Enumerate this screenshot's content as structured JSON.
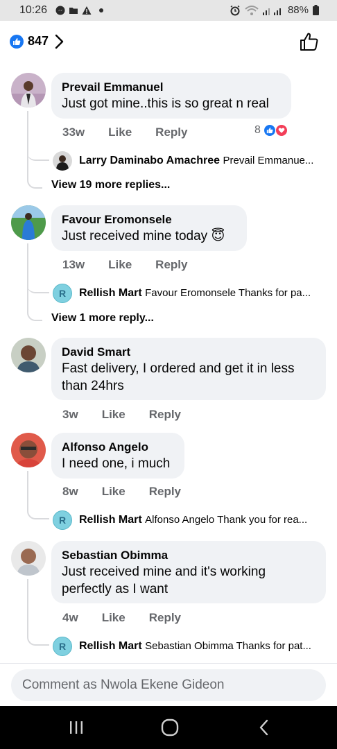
{
  "status_bar": {
    "time": "10:26",
    "battery": "88%"
  },
  "header": {
    "like_count": "847"
  },
  "comments": [
    {
      "author": "Prevail Emmanuel",
      "text": "Just got mine..this is so great n real",
      "age": "33w",
      "like": "Like",
      "reply": "Reply",
      "reaction_count": "8",
      "reply_preview": {
        "author": "Larry Daminabo Amachree",
        "snippet": "Prevail Emmanue..."
      },
      "view_more": "View 19 more replies..."
    },
    {
      "author": "Favour Eromonsele",
      "text": "Just received mine today 😇",
      "age": "13w",
      "like": "Like",
      "reply": "Reply",
      "reply_preview": {
        "author": "Rellish Mart",
        "avatar_letter": "R",
        "snippet": "Favour Eromonsele Thanks for pa..."
      },
      "view_more": "View 1 more reply..."
    },
    {
      "author": "David Smart",
      "text_line1": "Fast delivery, I ordered and get it in less",
      "text_line2": "than 24hrs",
      "age": "3w",
      "like": "Like",
      "reply": "Reply"
    },
    {
      "author": "Alfonso Angelo",
      "text": "I need one, i much",
      "age": "8w",
      "like": "Like",
      "reply": "Reply",
      "reply_preview": {
        "author": "Rellish Mart",
        "avatar_letter": "R",
        "snippet": "Alfonso Angelo Thank you for rea..."
      }
    },
    {
      "author": "Sebastian Obimma",
      "text_line1": "Just received mine and it's working",
      "text_line2": "perfectly as I want",
      "age": "4w",
      "like": "Like",
      "reply": "Reply",
      "reply_preview": {
        "author": "Rellish Mart",
        "avatar_letter": "R",
        "snippet": "Sebastian Obimma Thanks for pat..."
      }
    }
  ],
  "composer": {
    "placeholder": "Comment as Nwola Ekene Gideon"
  },
  "colors": {
    "accent": "#1877f2",
    "love": "#f33e58",
    "bubble": "#f0f2f5",
    "meta": "#65676b"
  }
}
